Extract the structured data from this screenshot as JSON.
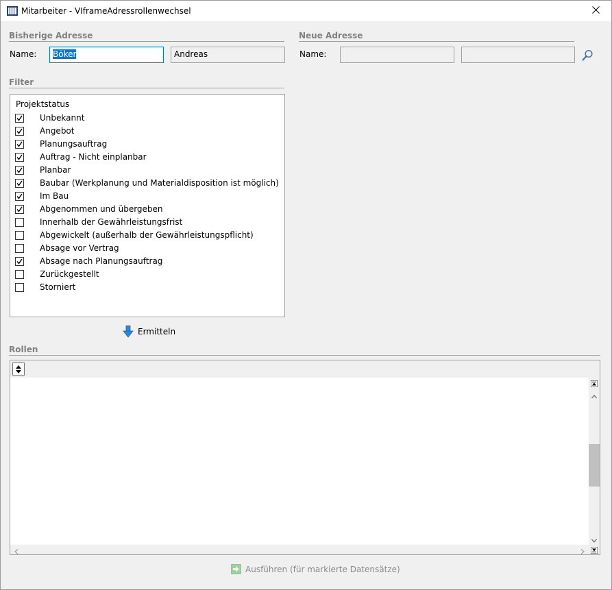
{
  "window": {
    "title": "Mitarbeiter - VIframeAdressrollenwechsel",
    "icon": "grid-app-icon",
    "close_icon": "close-icon"
  },
  "old_address": {
    "section_title": "Bisherige Adresse",
    "name_label": "Name:",
    "last_name": "Böker",
    "first_name": "Andreas"
  },
  "new_address": {
    "section_title": "Neue Adresse",
    "name_label": "Name:",
    "last_name": "",
    "first_name": "",
    "search_icon": "magnifier-icon"
  },
  "filter": {
    "section_title": "Filter",
    "list_heading": "Projektstatus",
    "items": [
      {
        "label": "Unbekannt",
        "checked": true
      },
      {
        "label": "Angebot",
        "checked": true
      },
      {
        "label": "Planungsauftrag",
        "checked": true
      },
      {
        "label": "Auftrag - Nicht einplanbar",
        "checked": true
      },
      {
        "label": "Planbar",
        "checked": true
      },
      {
        "label": "Baubar (Werkplanung und Materialdisposition ist möglich)",
        "checked": true
      },
      {
        "label": "Im Bau",
        "checked": true
      },
      {
        "label": "Abgenommen und übergeben",
        "checked": true
      },
      {
        "label": "Innerhalb der Gewährleistungsfrist",
        "checked": false
      },
      {
        "label": "Abgewickelt (außerhalb der Gewährleistungspflicht)",
        "checked": false
      },
      {
        "label": "Absage vor Vertrag",
        "checked": false
      },
      {
        "label": "Absage nach Planungsauftrag",
        "checked": true
      },
      {
        "label": "Zurückgestellt",
        "checked": false
      },
      {
        "label": "Storniert",
        "checked": false
      }
    ],
    "run_button": "Ermitteln",
    "run_icon": "arrow-down-icon"
  },
  "roles": {
    "section_title": "Rollen",
    "sort_icon": "sort-updown-icon"
  },
  "footer": {
    "execute_button": "Ausführen (für markierte Datensätze)",
    "execute_icon": "arrow-right-icon"
  },
  "colors": {
    "accent": "#0078d7",
    "section_title": "#808080",
    "disabled_text": "#8a8a8a",
    "run_arrow": "#2b8ad8",
    "execute_arrow": "#9bd49b"
  }
}
